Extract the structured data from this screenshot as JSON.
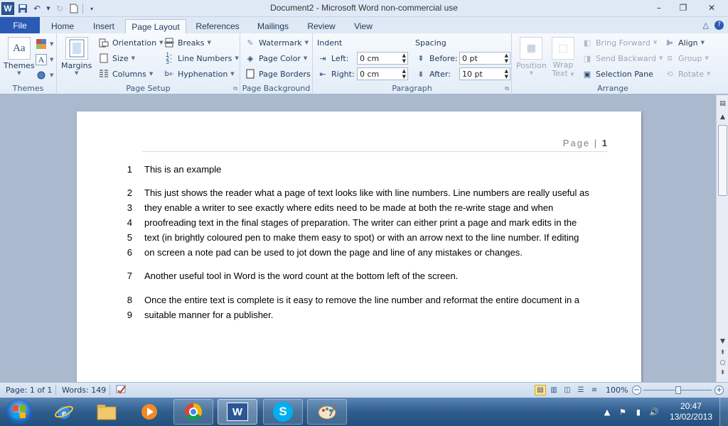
{
  "window": {
    "title": "Document2 - Microsoft Word non-commercial use",
    "app_logo": "W",
    "icons": {
      "save": "save-icon",
      "undo": "undo-icon",
      "redo": "redo-icon",
      "new": "new-document-icon",
      "customize": "customize-qat-icon"
    },
    "controls": {
      "minimize": "–",
      "restore": "❐",
      "close": "✕"
    }
  },
  "tabs": [
    {
      "label": "File"
    },
    {
      "label": "Home"
    },
    {
      "label": "Insert"
    },
    {
      "label": "Page Layout"
    },
    {
      "label": "References"
    },
    {
      "label": "Mailings"
    },
    {
      "label": "Review"
    },
    {
      "label": "View"
    }
  ],
  "active_tab": "Page Layout",
  "ribbon": {
    "themes": {
      "label": "Themes",
      "themes_button": "Themes"
    },
    "page_setup": {
      "label": "Page Setup",
      "margins": "Margins",
      "orientation": "Orientation",
      "size": "Size",
      "columns": "Columns",
      "breaks": "Breaks",
      "line_numbers": "Line Numbers",
      "hyphenation": "Hyphenation"
    },
    "page_background": {
      "label": "Page Background",
      "watermark": "Watermark",
      "page_color": "Page Color",
      "page_borders": "Page Borders"
    },
    "paragraph": {
      "label": "Paragraph",
      "indent_header": "Indent",
      "left_label": "Left:",
      "left_value": "0 cm",
      "right_label": "Right:",
      "right_value": "0 cm",
      "spacing_header": "Spacing",
      "before_label": "Before:",
      "before_value": "0 pt",
      "after_label": "After:",
      "after_value": "10 pt"
    },
    "arrange": {
      "label": "Arrange",
      "position": "Position",
      "wrap_text_1": "Wrap",
      "wrap_text_2": "Text",
      "bring_forward": "Bring Forward",
      "send_backward": "Send Backward",
      "selection_pane": "Selection Pane",
      "align": "Align",
      "group": "Group",
      "rotate": "Rotate"
    }
  },
  "document": {
    "header_page": "Page",
    "header_num": "1",
    "lines": [
      {
        "num": "1",
        "text": "This is an example"
      },
      {
        "num": "2",
        "text": "This just shows the reader what a page of text looks like with line numbers. Line numbers are really useful as"
      },
      {
        "num": "3",
        "text": "they enable a writer to see exactly where edits need to be made at both the re-write stage and when"
      },
      {
        "num": "4",
        "text": "proofreading text in the final stages of preparation. The writer can either print a page and mark edits in the"
      },
      {
        "num": "5",
        "text": "text (in brightly coloured pen to make them easy to spot) or with an arrow next to the line number. If editing"
      },
      {
        "num": "6",
        "text": "on screen a note pad can be used to jot down the page and line of any mistakes or changes."
      },
      {
        "num": "7",
        "text": "Another useful tool in Word is the word count at the bottom left of the screen."
      },
      {
        "num": "8",
        "text": "Once the entire text is complete is it easy to remove the line number and reformat the entire document in a"
      },
      {
        "num": "9",
        "text": "suitable manner for a publisher."
      }
    ]
  },
  "statusbar": {
    "page": "Page: 1 of 1",
    "words": "Words: 149",
    "zoom": "100%",
    "zoom_level": 100
  },
  "taskbar": {
    "apps": [
      "internet-explorer-icon",
      "file-explorer-icon",
      "media-player-icon",
      "chrome-icon",
      "word-icon",
      "skype-icon",
      "paint-icon"
    ],
    "time": "20:47",
    "date": "13/02/2013"
  },
  "colors": {
    "file_tab": "#2a5ab4",
    "ribbon_bg": "#e3ecf7",
    "doc_bg": "#abb9ce",
    "taskbar": "#2f5d8c"
  }
}
